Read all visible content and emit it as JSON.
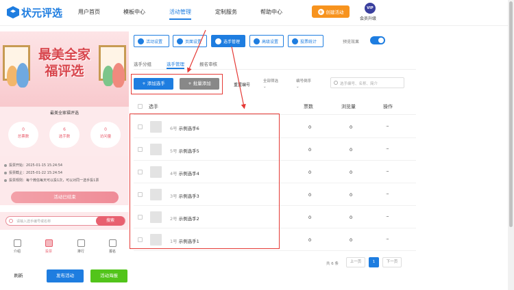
{
  "app": {
    "logo_text": "状元评选"
  },
  "nav": {
    "items": [
      "用户首页",
      "模板中心",
      "活动管理",
      "定制服务",
      "帮助中心"
    ],
    "active_index": 2,
    "create_label": "创建活动",
    "vip_badge": "VIP",
    "vip_label": "会员升级"
  },
  "preview": {
    "banner_title_line1": "最美全家",
    "banner_title_line2": "福评选",
    "activity_name": "最美全家福评选",
    "stats": [
      {
        "value": "0",
        "label": "总票数"
      },
      {
        "value": "6",
        "label": "选手数"
      },
      {
        "value": "0",
        "label": "访问量"
      }
    ],
    "info_rows": [
      "投票开始：2025-01-15 15:24:54",
      "投票截止：2025-01-22 15:24:54",
      "投票规则：每个微信每天可以投1次，可以对同一选手投1票"
    ],
    "ended_label": "活动已结束",
    "search_placeholder": "请输入选手编号或名称",
    "search_button": "搜索",
    "tabbar": [
      {
        "label": "介绍",
        "icon": "intro-icon"
      },
      {
        "label": "投票",
        "icon": "bar-chart-icon"
      },
      {
        "label": "排行",
        "icon": "ranking-icon"
      },
      {
        "label": "报名",
        "icon": "signup-icon"
      }
    ],
    "tabbar_active": 1
  },
  "bottom_buttons": {
    "refresh": "刷新",
    "publish": "发布活动",
    "poster": "活动海报"
  },
  "toolbar": {
    "buttons": [
      "活动设置",
      "页面设置",
      "选手管理",
      "高级设置",
      "投票统计"
    ],
    "active_index": 2,
    "preview_label": "预览效果",
    "preview_on": true
  },
  "subtabs": {
    "items": [
      "选手分组",
      "选手管理",
      "报名审核"
    ],
    "active_index": 1
  },
  "actions": {
    "add_label": "+ 添加选手",
    "batch_label": "+ 批量添加",
    "reset_label": "重置编号",
    "filter_all": "全部筛选",
    "filter_order": "编号倒序",
    "search_placeholder": "选手编号、名称、简介"
  },
  "table": {
    "headers": {
      "player": "选手",
      "votes": "票数",
      "views": "浏览量",
      "ops": "操作"
    },
    "rows": [
      {
        "no": "6号",
        "name": "示例选手6",
        "votes": "0",
        "views": "0",
        "op": "···"
      },
      {
        "no": "5号",
        "name": "示例选手5",
        "votes": "0",
        "views": "0",
        "op": "···"
      },
      {
        "no": "4号",
        "name": "示例选手4",
        "votes": "0",
        "views": "0",
        "op": "···"
      },
      {
        "no": "3号",
        "name": "示例选手3",
        "votes": "0",
        "views": "0",
        "op": "···"
      },
      {
        "no": "2号",
        "name": "示例选手2",
        "votes": "0",
        "views": "0",
        "op": "···"
      },
      {
        "no": "1号",
        "name": "示例选手1",
        "votes": "0",
        "views": "0",
        "op": "···"
      }
    ]
  },
  "pagination": {
    "total": "共 6 条",
    "prev": "上一页",
    "current": "1",
    "next": "下一页"
  },
  "colors": {
    "primary": "#1e7de0",
    "orange": "#f7931e",
    "green": "#52c41a",
    "annotation_red": "#e53935",
    "pink": "#e8606f"
  }
}
